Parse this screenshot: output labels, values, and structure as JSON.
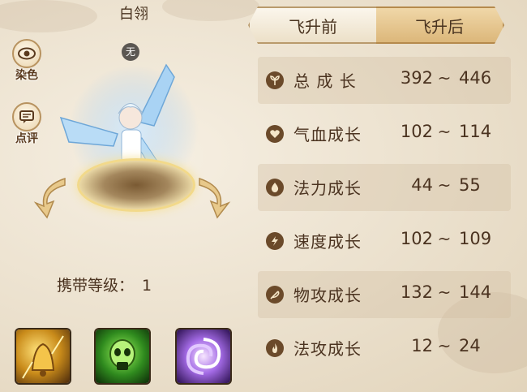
{
  "pet": {
    "name": "白翎",
    "badge": "无",
    "carry_label": "携带等级：",
    "carry_level": "1"
  },
  "side_buttons": {
    "dye": {
      "label": "染色",
      "icon": "eye-icon"
    },
    "review": {
      "label": "点评",
      "icon": "comment-icon"
    }
  },
  "tabs": [
    {
      "label": "飞升前",
      "active": false
    },
    {
      "label": "飞升后",
      "active": true
    }
  ],
  "stats": [
    {
      "label": "总 成 长",
      "min": "392",
      "max": "446",
      "icon": "sprout-icon"
    },
    {
      "label": "气血成长",
      "min": "102",
      "max": "114",
      "icon": "heart-icon"
    },
    {
      "label": "法力成长",
      "min": "44",
      "max": "55",
      "icon": "droplet-icon"
    },
    {
      "label": "速度成长",
      "min": "102",
      "max": "109",
      "icon": "lightning-icon"
    },
    {
      "label": "物攻成长",
      "min": "132",
      "max": "144",
      "icon": "feather-icon"
    },
    {
      "label": "法攻成长",
      "min": "12",
      "max": "24",
      "icon": "flame-icon"
    }
  ],
  "tilde": "~",
  "skills": [
    {
      "name": "golden-bell-skill-icon"
    },
    {
      "name": "poison-skull-skill-icon"
    },
    {
      "name": "purple-swirl-skill-icon"
    }
  ],
  "colors": {
    "panel_text": "#4b3320",
    "active_tab": "#dcb77a",
    "stat_icon_bg": "#6b4a2a"
  }
}
